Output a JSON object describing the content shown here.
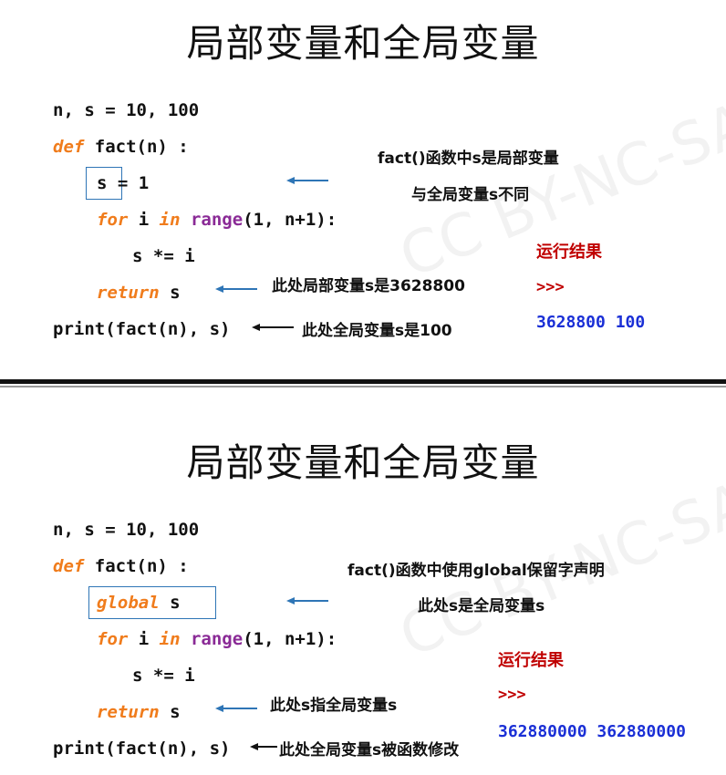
{
  "slide1": {
    "title": "局部变量和全局变量",
    "code": {
      "line1": "n, s = 10, 100",
      "def_kw": "def",
      "def_rest": " fact(n) :",
      "line3": "s = 1",
      "for_kw": "for",
      "for_mid": " i ",
      "in_kw": "in",
      "range_fn": " range",
      "for_rest": "(1, n+1):",
      "line5": "s *= i",
      "return_kw": "return",
      "return_rest": " s",
      "line7": "print(fact(n), s)"
    },
    "notes": {
      "note1": "fact()函数中s是局部变量",
      "note2": "与全局变量s不同",
      "note3": "此处局部变量s是3628800",
      "note4": "此处全局变量s是100"
    },
    "result": {
      "label": "运行结果",
      "prompt": ">>>",
      "value": "3628800 100"
    }
  },
  "slide2": {
    "title": "局部变量和全局变量",
    "code": {
      "line1": "n, s = 10, 100",
      "def_kw": "def",
      "def_rest": " fact(n) :",
      "global_kw": "global",
      "global_rest": " s",
      "for_kw": "for",
      "for_mid": " i ",
      "in_kw": "in",
      "range_fn": " range",
      "for_rest": "(1, n+1):",
      "line5": "s *= i",
      "return_kw": "return",
      "return_rest": " s",
      "line7": "print(fact(n), s)"
    },
    "notes": {
      "note1": "fact()函数中使用global保留字声明",
      "note2": "此处s是全局变量s",
      "note3": "此处s指全局变量s",
      "note4": "此处全局变量s被函数修改"
    },
    "result": {
      "label": "运行结果",
      "prompt": ">>>",
      "value": "362880000 362880000"
    }
  },
  "colors": {
    "keyword": "#f07c1c",
    "function": "#8a2a96",
    "result_label": "#c00000",
    "result_value": "#1a2fd6",
    "box": "#2e75b6"
  }
}
